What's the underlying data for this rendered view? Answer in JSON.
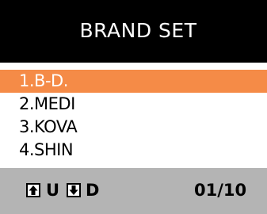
{
  "header": {
    "title": "BRAND SET"
  },
  "brands": [
    {
      "label": "1.B-D.",
      "selected": true
    },
    {
      "label": "2.MEDI",
      "selected": false
    },
    {
      "label": "3.KOVA",
      "selected": false
    },
    {
      "label": "4.SHIN",
      "selected": false
    }
  ],
  "footer": {
    "up_icon": "arrow-up-icon",
    "up_label": "U",
    "down_icon": "arrow-down-icon",
    "down_label": "D",
    "page_indicator": "01/10"
  },
  "colors": {
    "header_background": "#000000",
    "header_text": "#ffffff",
    "selected_background": "#f58b47",
    "selected_text": "#ffffff",
    "footer_background": "#b4b4b4"
  }
}
